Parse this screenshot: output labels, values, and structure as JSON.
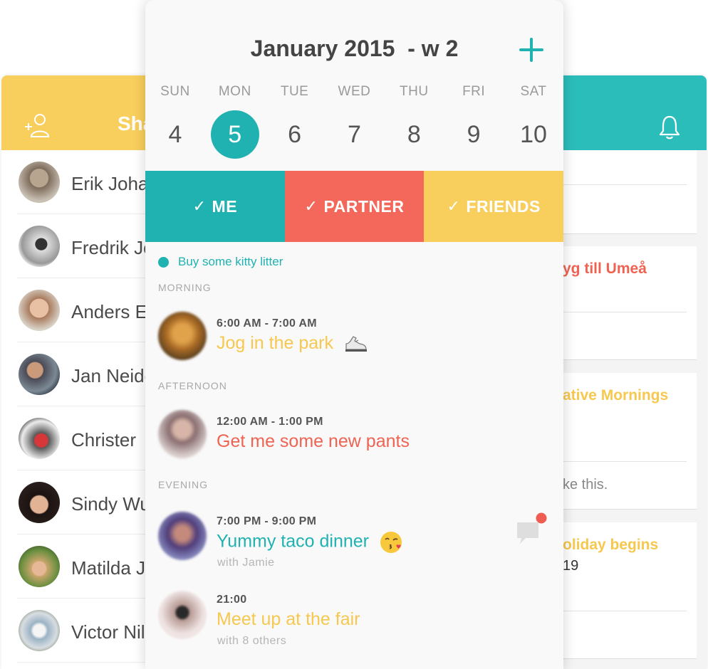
{
  "left_panel": {
    "title": "Sha",
    "contacts": [
      {
        "name": "Erik Johansson"
      },
      {
        "name": "Fredrik Jonsson"
      },
      {
        "name": "Anders Ek"
      },
      {
        "name": "Jan Neiderud"
      },
      {
        "name": "Christer"
      },
      {
        "name": "Sindy Wu"
      },
      {
        "name": "Matilda J"
      },
      {
        "name": "Victor Nilsson"
      }
    ]
  },
  "calendar": {
    "title": "January 2015  - w 2",
    "weekdays": [
      "SUN",
      "MON",
      "TUE",
      "WED",
      "THU",
      "FRI",
      "SAT"
    ],
    "dates": [
      "4",
      "5",
      "6",
      "7",
      "8",
      "9",
      "10"
    ],
    "selected_date": "5",
    "filters": [
      {
        "label": "ME",
        "color": "#20b2b1"
      },
      {
        "label": "PARTNER",
        "color": "#f3685a"
      },
      {
        "label": "FRIENDS",
        "color": "#f8cf5c"
      }
    ],
    "todo": "Buy some kitty litter",
    "sections": {
      "morning": "MORNING",
      "afternoon": "AFTERNOON",
      "evening": "EVENING"
    },
    "events": [
      {
        "time": "6:00 AM - 7:00 AM",
        "title": "Jog in the park",
        "color": "#f7c84f",
        "emoji": "sneaker-icon"
      },
      {
        "time": "12:00 AM - 1:00 PM",
        "title": "Get me some new pants",
        "color": "#ee6352"
      },
      {
        "time": "7:00 PM - 9:00 PM",
        "title": "Yummy taco dinner",
        "with": "with Jamie",
        "color": "#20b2b1",
        "emoji": "kiss-face-icon",
        "has_unread_comment": true
      },
      {
        "time": "21:00",
        "title": "Meet up at the fair",
        "with": "with 8 others",
        "color": "#f7c84f"
      }
    ]
  },
  "right_panel": {
    "cards": [
      {
        "title": "yg till Umeå",
        "color": "#ee6352"
      },
      {
        "title": "ative Mornings",
        "color": "#f7c84f",
        "text": "ke this."
      },
      {
        "title": "oliday begins",
        "color": "#f7c84f",
        "text": "19"
      }
    ]
  },
  "colors": {
    "accent_teal": "#20b2b1",
    "accent_coral": "#f3685a",
    "accent_yellow": "#f8cf5c"
  }
}
